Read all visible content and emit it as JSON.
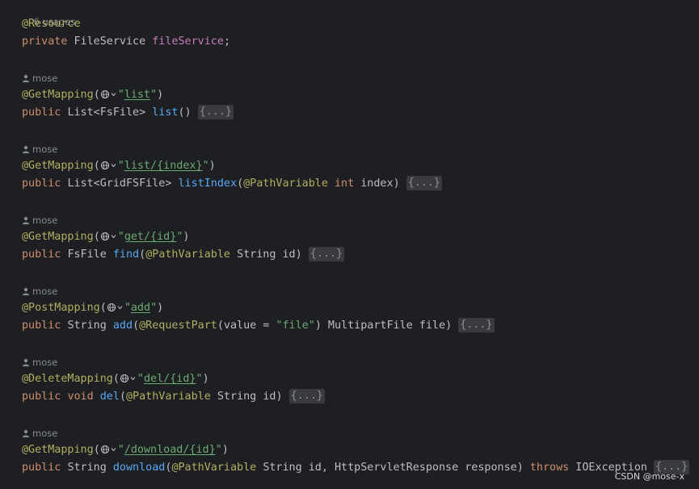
{
  "header": {
    "usages": "6 usages",
    "resource_annotation": "@Resource",
    "field_modifier": "private",
    "field_type": "FileService",
    "field_name": "fileService",
    "semicolon": ";"
  },
  "methods": [
    {
      "author": "mose",
      "annotation": "@GetMapping",
      "url": "list",
      "modifier": "public",
      "return_type": "List<FsFile>",
      "name": "list",
      "params": "()",
      "fold": "{...}"
    },
    {
      "author": "mose",
      "annotation": "@GetMapping",
      "url": "list/{index}",
      "modifier": "public",
      "return_type": "List<GridFSFile>",
      "name": "listIndex",
      "param_annotation": "@PathVariable",
      "param_type": "int",
      "param_name": "index",
      "fold": "{...}"
    },
    {
      "author": "mose",
      "annotation": "@GetMapping",
      "url": "get/{id}",
      "modifier": "public",
      "return_type": "FsFile",
      "name": "find",
      "param_annotation": "@PathVariable",
      "param_type": "String",
      "param_name": "id",
      "fold": "{...}"
    },
    {
      "author": "mose",
      "annotation": "@PostMapping",
      "url": "add",
      "modifier": "public",
      "return_type": "String",
      "name": "add",
      "param_annotation": "@RequestPart",
      "param_attr": "(value = ",
      "param_attr_value": "\"file\"",
      "param_rest": ") MultipartFile file",
      "fold": "{...}"
    },
    {
      "author": "mose",
      "annotation": "@DeleteMapping",
      "url": "del/{id}",
      "modifier": "public",
      "return_type": "void",
      "name": "del",
      "param_annotation": "@PathVariable",
      "param_type": "String",
      "param_name": "id",
      "fold": "{...}"
    },
    {
      "author": "mose",
      "annotation": "@GetMapping",
      "url": "/download/{id}",
      "modifier": "public",
      "return_type": "String",
      "name": "download",
      "param_annotation": "@PathVariable",
      "param_type": "String",
      "param_name": "id",
      "param_rest": ", HttpServletResponse response",
      "throws_kw": "throws",
      "exception": "IOException",
      "fold": "{...}"
    }
  ],
  "watermark": "CSDN @mose-x",
  "icons": {
    "author": "person-icon",
    "endpoint": "globe-icon"
  },
  "colors": {
    "background": "#1e1f22",
    "keyword": "#cf8e6d",
    "annotation": "#b3ae60",
    "function": "#56a8f5",
    "field": "#c77dbb",
    "string": "#6aab73"
  }
}
